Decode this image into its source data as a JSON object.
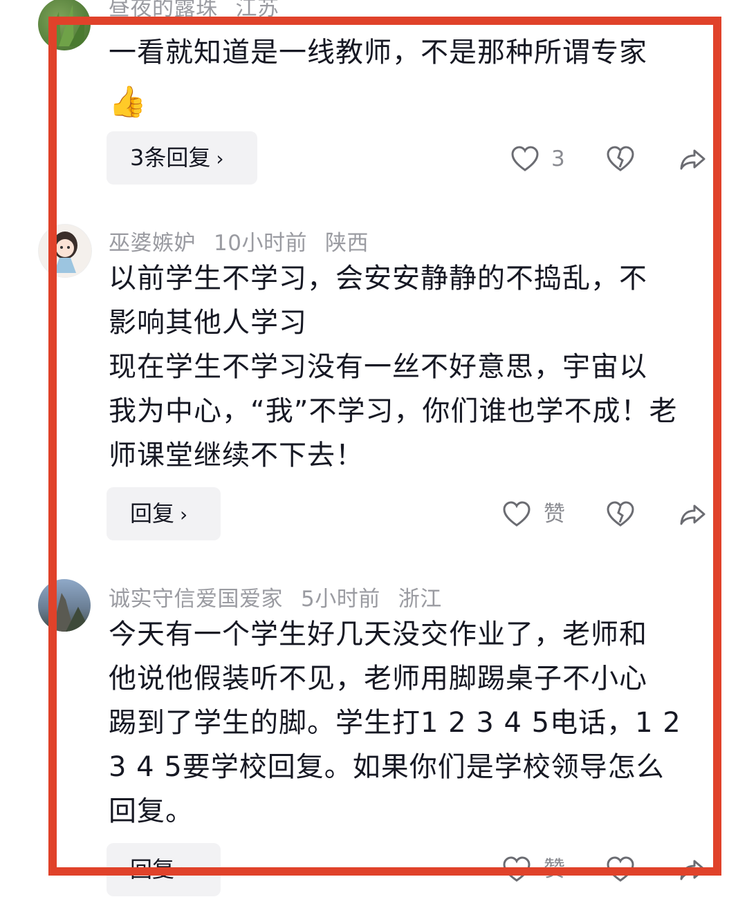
{
  "comments": [
    {
      "username": "昼夜的露珠",
      "time": "",
      "location": "江苏",
      "text": "一看就知道是一线教师，不是那种所谓专家",
      "emoji": "👍",
      "reply_label": "3条回复",
      "like_count": "3"
    },
    {
      "username": "巫婆嫉妒",
      "time": "10小时前",
      "location": "陕西",
      "text": "以前学生不学习，会安安静静的不捣乱，不\n影响其他人学习\n现在学生不学习没有一丝不好意思，宇宙以\n我为中心，“我”不学习，你们谁也学不成！老\n师课堂继续不下去！",
      "reply_label": "回复",
      "like_count": "赞"
    },
    {
      "username": "诚实守信爱国爱家",
      "time": "5小时前",
      "location": "浙江",
      "text": "今天有一个学生好几天没交作业了，老师和\n他说他假装听不见，老师用脚踢桌子不小心\n踢到了学生的脚。学生打1 2 3 4 5电话，1 2\n3 4 5要学校回复。如果你们是学校领导怎么\n回复。",
      "reply_label": "回复",
      "like_count": "赞"
    }
  ],
  "chevron": "›",
  "colors": {
    "frame": "#e0422a",
    "meta": "#9a9ba1",
    "button_bg": "#f2f2f4"
  },
  "icons": [
    "heart-outline-icon",
    "broken-heart-icon",
    "share-arrow-icon",
    "thumbs-up-emoji"
  ]
}
